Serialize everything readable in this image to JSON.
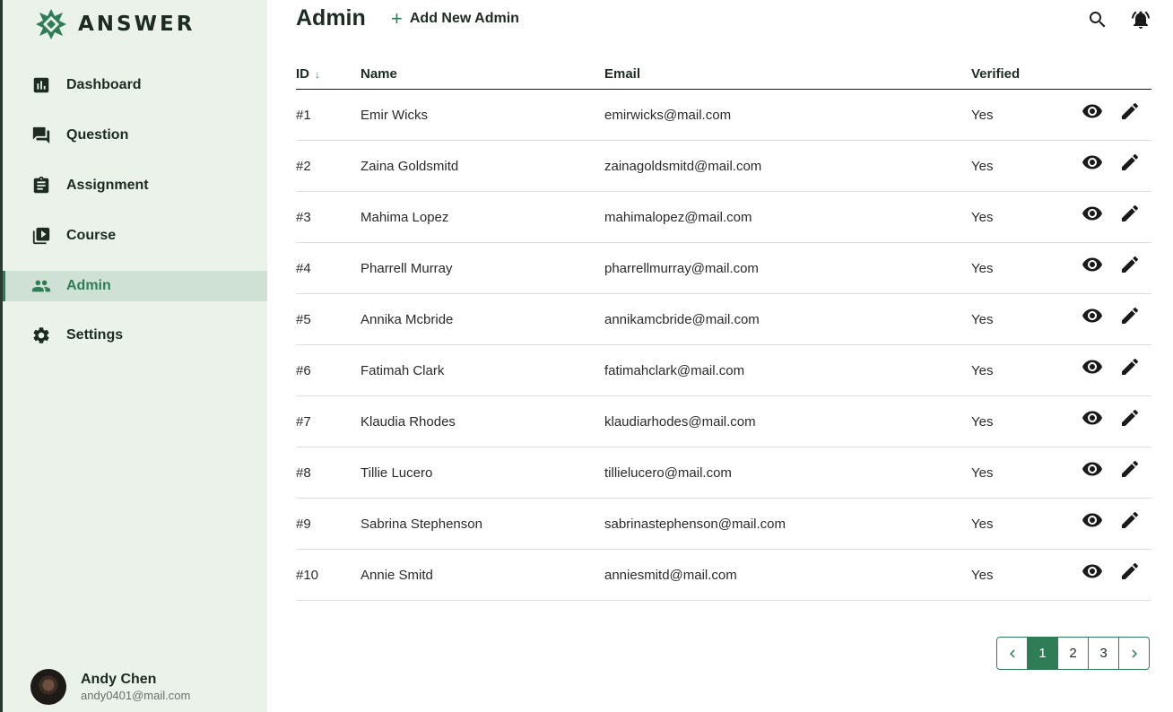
{
  "app": {
    "name": "ANSWER"
  },
  "sidebar": {
    "items": [
      {
        "label": "Dashboard",
        "icon": "bar-chart-icon"
      },
      {
        "label": "Question",
        "icon": "forum-icon"
      },
      {
        "label": "Assignment",
        "icon": "clipboard-icon"
      },
      {
        "label": "Course",
        "icon": "video-library-icon"
      },
      {
        "label": "Admin",
        "icon": "people-icon",
        "active": true
      },
      {
        "label": "Settings",
        "icon": "gear-icon"
      }
    ]
  },
  "user": {
    "name": "Andy Chen",
    "email": "andy0401@mail.com"
  },
  "header": {
    "title": "Admin",
    "add_button_label": "Add New Admin",
    "add_icon": "+",
    "search_icon": "search-icon",
    "notification_icon": "bell-icon"
  },
  "table": {
    "columns": {
      "id": "ID",
      "name": "Name",
      "email": "Email",
      "verified": "Verified"
    },
    "sort_indicator": "↓",
    "rows": [
      {
        "id": "#1",
        "name": "Emir Wicks",
        "email": "emirwicks@mail.com",
        "verified": "Yes"
      },
      {
        "id": "#2",
        "name": "Zaina Goldsmitd",
        "email": "zainagoldsmitd@mail.com",
        "verified": "Yes"
      },
      {
        "id": "#3",
        "name": "Mahima Lopez",
        "email": "mahimalopez@mail.com",
        "verified": "Yes"
      },
      {
        "id": "#4",
        "name": "Pharrell Murray",
        "email": "pharrellmurray@mail.com",
        "verified": "Yes"
      },
      {
        "id": "#5",
        "name": "Annika Mcbride",
        "email": "annikamcbride@mail.com",
        "verified": "Yes"
      },
      {
        "id": "#6",
        "name": "Fatimah Clark",
        "email": "fatimahclark@mail.com",
        "verified": "Yes"
      },
      {
        "id": "#7",
        "name": "Klaudia Rhodes",
        "email": "klaudiarhodes@mail.com",
        "verified": "Yes"
      },
      {
        "id": "#8",
        "name": "Tillie Lucero",
        "email": "tillielucero@mail.com",
        "verified": "Yes"
      },
      {
        "id": "#9",
        "name": "Sabrina Stephenson",
        "email": "sabrinastephenson@mail.com",
        "verified": "Yes"
      },
      {
        "id": "#10",
        "name": "Annie Smitd",
        "email": "anniesmitd@mail.com",
        "verified": "Yes"
      }
    ]
  },
  "pagination": {
    "pages": [
      "1",
      "2",
      "3"
    ],
    "current": "1"
  },
  "colors": {
    "accent": "#2e7d57",
    "sidebar_bg": "#eaf2ea",
    "active_bg": "#cfe1d4"
  }
}
